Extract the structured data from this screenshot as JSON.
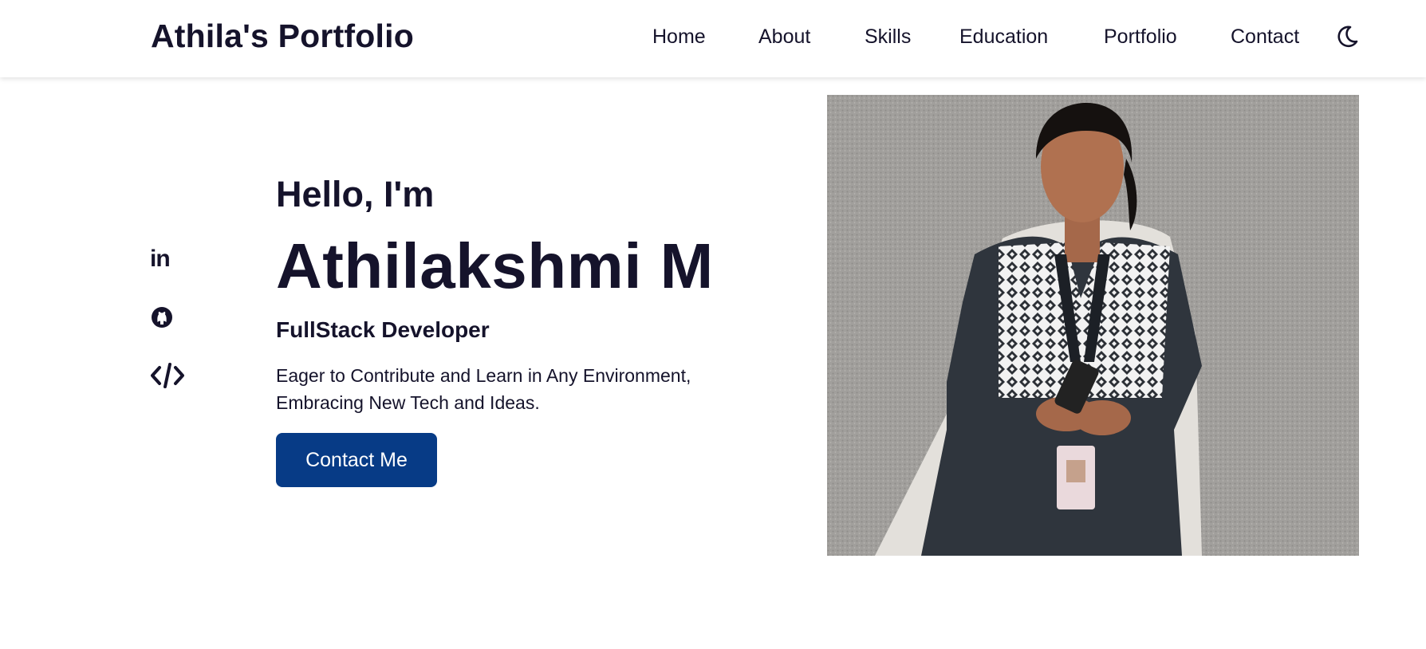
{
  "header": {
    "brand": "Athila's Portfolio",
    "nav": [
      {
        "label": "Home"
      },
      {
        "label": "About"
      },
      {
        "label": "Skills"
      },
      {
        "label": "Education"
      },
      {
        "label": "Portfolio"
      },
      {
        "label": "Contact"
      }
    ],
    "theme_icon": "moon-icon"
  },
  "socials": [
    {
      "icon": "linkedin-icon",
      "text": "in"
    },
    {
      "icon": "github-icon"
    },
    {
      "icon": "code-icon"
    }
  ],
  "hero": {
    "greeting": "Hello, I'm",
    "name": "Athilakshmi M",
    "role": "FullStack Developer",
    "description": "Eager to Contribute and Learn in Any Environment, Embracing New Tech and Ideas.",
    "cta_label": "Contact Me"
  },
  "colors": {
    "text": "#15132b",
    "accent": "#073b86",
    "background": "#ffffff"
  }
}
